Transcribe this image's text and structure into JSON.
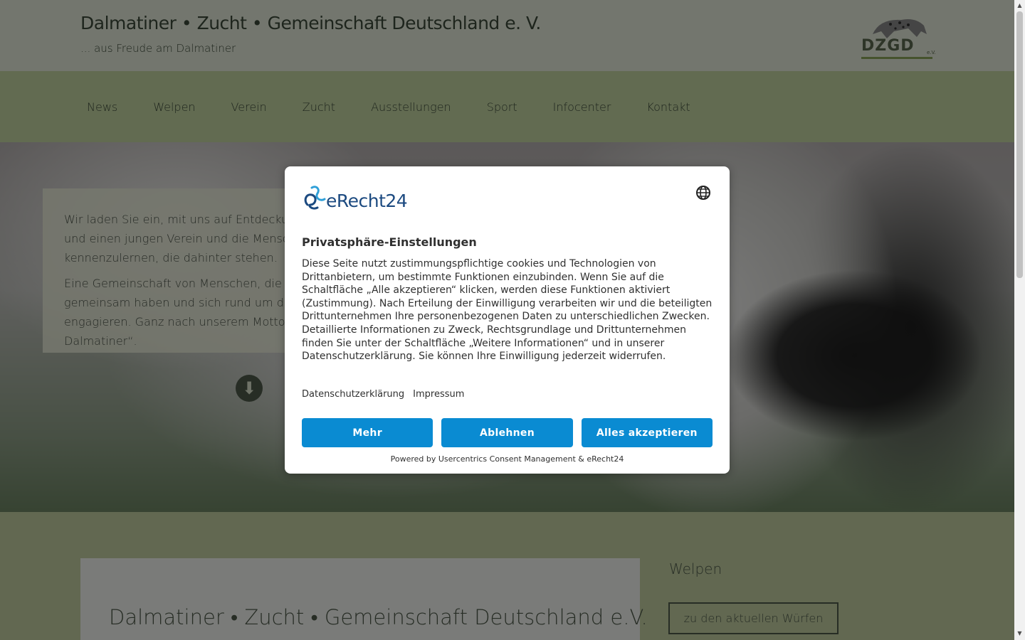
{
  "site": {
    "title": "Dalmatiner • Zucht • Gemeinschaft Deutschland e. V.",
    "tagline": "... aus Freude am Dalmatiner",
    "logo_text": "DZGD",
    "logo_suffix": "e.V."
  },
  "nav": {
    "items": [
      "News",
      "Welpen",
      "Verein",
      "Zucht",
      "Ausstellungen",
      "Sport",
      "Infocenter",
      "Kontakt"
    ]
  },
  "hero": {
    "paragraph1": "Wir laden Sie ein, mit uns auf Entdeckungsreise zu gehen und einen jungen Verein und die Menschen kennenzulernen, die dahinter stehen.",
    "paragraph2": "Eine Gemeinschaft von Menschen, die alle eines gemeinsam haben und sich rund um den Dalmatiner engagieren. Ganz nach unserem Motto: „... aus Freude am Dalmatiner“.",
    "scroll_icon": "arrow-down-icon"
  },
  "main": {
    "title": "Dalmatiner • Zucht • Gemeinschaft Deutschland e.V."
  },
  "sidebar": {
    "heading": "Welpen",
    "button_label": "zu den aktuellen Würfen"
  },
  "consent": {
    "brand": "eRecht24",
    "title": "Privatsphäre-Einstellungen",
    "body": "Diese Seite nutzt zustimmungspflichtige cookies und Technologien von Drittanbietern, um bestimmte Funktionen einzubinden. Wenn Sie auf die Schaltfläche „Alle akzeptieren“ klicken, werden diese Funktionen aktiviert (Zustimmung). Nach Erteilung der Einwilligung verarbeiten wir und die beteiligten Drittunternehmen Ihre personenbezogenen Daten zu unterschiedlichen Zwecken. Detaillierte Informationen zu Zweck, Rechtsgrundlage und Drittunternehmen finden Sie unter der Schaltfläche „Weitere Informationen“ und in unserer Datenschutzerklärung. Sie können Ihre Einwilligung jederzeit widerrufen.",
    "links": [
      "Datenschutzerklärung",
      "Impressum"
    ],
    "buttons": {
      "more": "Mehr",
      "decline": "Ablehnen",
      "accept_all": "Alles akzeptieren"
    },
    "powered_by": "Powered by Usercentrics Consent Management & eRecht24",
    "accent_color": "#0a8bd2",
    "language_icon": "globe-icon"
  }
}
